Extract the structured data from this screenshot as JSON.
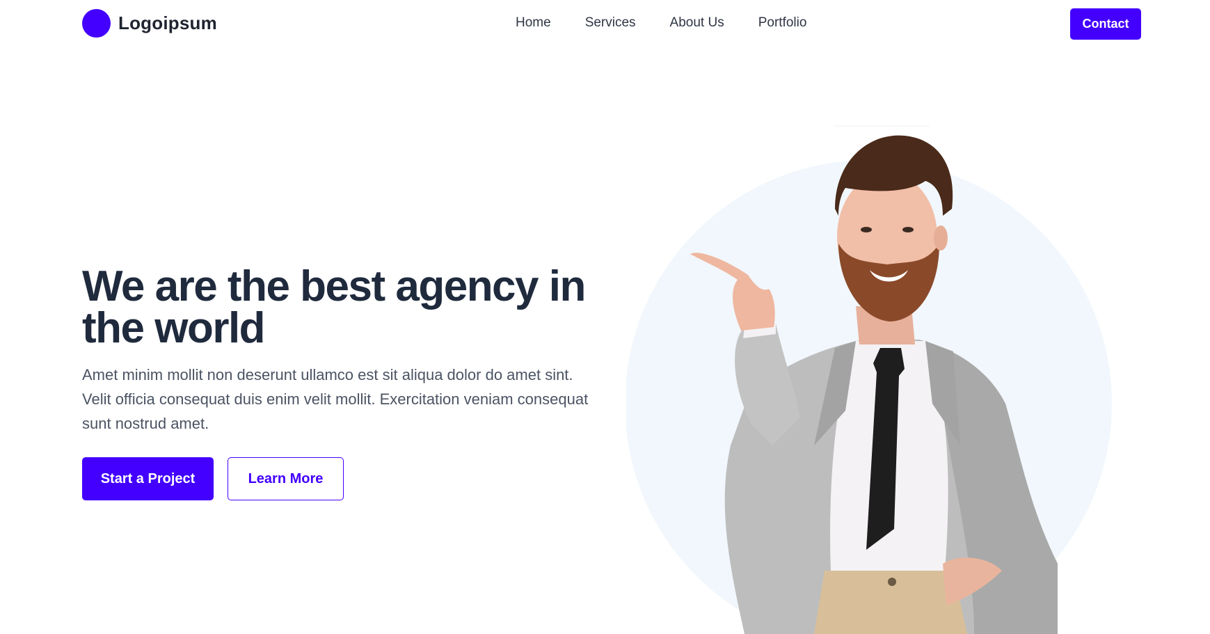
{
  "brand": {
    "name": "Logoipsum",
    "accent_color": "#4300ff"
  },
  "nav": {
    "items": [
      "Home",
      "Services",
      "About Us",
      "Portfolio"
    ],
    "contact_label": "Contact"
  },
  "hero": {
    "title": "We are the best agency in the world",
    "subtitle": "Amet minim mollit non deserunt ullamco est sit aliqua dolor do amet sint. Velit officia consequat duis enim velit mollit. Exercitation veniam consequat sunt nostrud amet.",
    "primary_cta": "Start a Project",
    "secondary_cta": "Learn More",
    "image_circle_color": "#f1f7fc"
  }
}
